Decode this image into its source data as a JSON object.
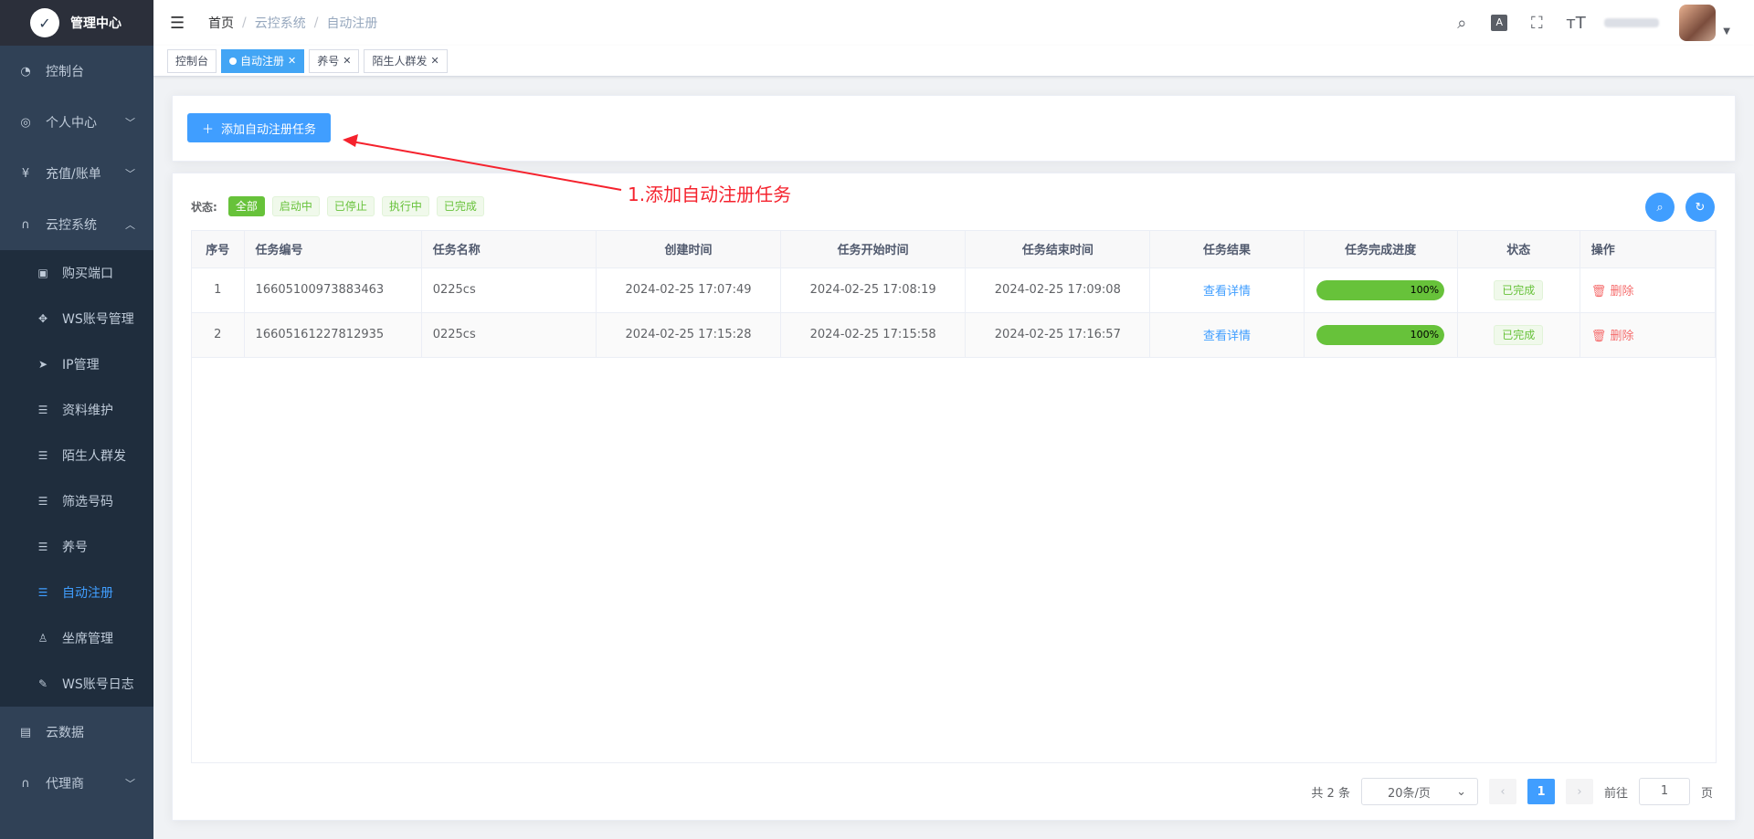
{
  "app": {
    "title": "管理中心",
    "logo_icon": "bird-logo"
  },
  "sidebar": {
    "items": [
      {
        "label": "控制台",
        "icon": "dashboard-icon"
      },
      {
        "label": "个人中心",
        "icon": "user-circle-icon"
      },
      {
        "label": "充值/账单",
        "icon": "yen-icon"
      },
      {
        "label": "云控系统",
        "icon": "headset-icon"
      }
    ],
    "subitems": [
      {
        "label": "购买端口"
      },
      {
        "label": "WS账号管理"
      },
      {
        "label": "IP管理"
      },
      {
        "label": "资料维护"
      },
      {
        "label": "陌生人群发"
      },
      {
        "label": "筛选号码"
      },
      {
        "label": "养号"
      },
      {
        "label": "自动注册"
      },
      {
        "label": "坐席管理"
      },
      {
        "label": "WS账号日志"
      }
    ],
    "bottom_items": [
      {
        "label": "云数据"
      },
      {
        "label": "代理商"
      }
    ],
    "active": "自动注册"
  },
  "header": {
    "breadcrumb": [
      "首页",
      "云控系统",
      "自动注册"
    ]
  },
  "tags": [
    {
      "label": "控制台",
      "active": false
    },
    {
      "label": "自动注册",
      "active": true
    },
    {
      "label": "养号",
      "active": false
    },
    {
      "label": "陌生人群发",
      "active": false
    }
  ],
  "toolbar": {
    "add_label": "添加自动注册任务"
  },
  "annotation": {
    "text": "1.添加自动注册任务"
  },
  "filter": {
    "label": "状态:",
    "chips": [
      "全部",
      "启动中",
      "已停止",
      "执行中",
      "已完成"
    ],
    "selected": "全部"
  },
  "table": {
    "columns": [
      "序号",
      "任务编号",
      "任务名称",
      "创建时间",
      "任务开始时间",
      "任务结束时间",
      "任务结果",
      "任务完成进度",
      "状态",
      "操作"
    ],
    "rows": [
      {
        "index": "1",
        "task_id": "16605100973883463",
        "name": "0225cs",
        "created": "2024-02-25 17:07:49",
        "start": "2024-02-25 17:08:19",
        "end": "2024-02-25 17:09:08",
        "result": "查看详情",
        "progress": 100,
        "progress_label": "100%",
        "status": "已完成",
        "action": "删除"
      },
      {
        "index": "2",
        "task_id": "16605161227812935",
        "name": "0225cs",
        "created": "2024-02-25 17:15:28",
        "start": "2024-02-25 17:15:58",
        "end": "2024-02-25 17:16:57",
        "result": "查看详情",
        "progress": 100,
        "progress_label": "100%",
        "status": "已完成",
        "action": "删除"
      }
    ]
  },
  "pagination": {
    "total_label": "共 2 条",
    "page_size": "20条/页",
    "current_page": "1",
    "goto_label": "前往",
    "goto_value": "1",
    "page_suffix": "页"
  },
  "colors": {
    "primary": "#409eff",
    "success": "#67c23a",
    "danger": "#f56c6c",
    "sidebar_bg": "#304156",
    "annotation": "#f5222d"
  }
}
